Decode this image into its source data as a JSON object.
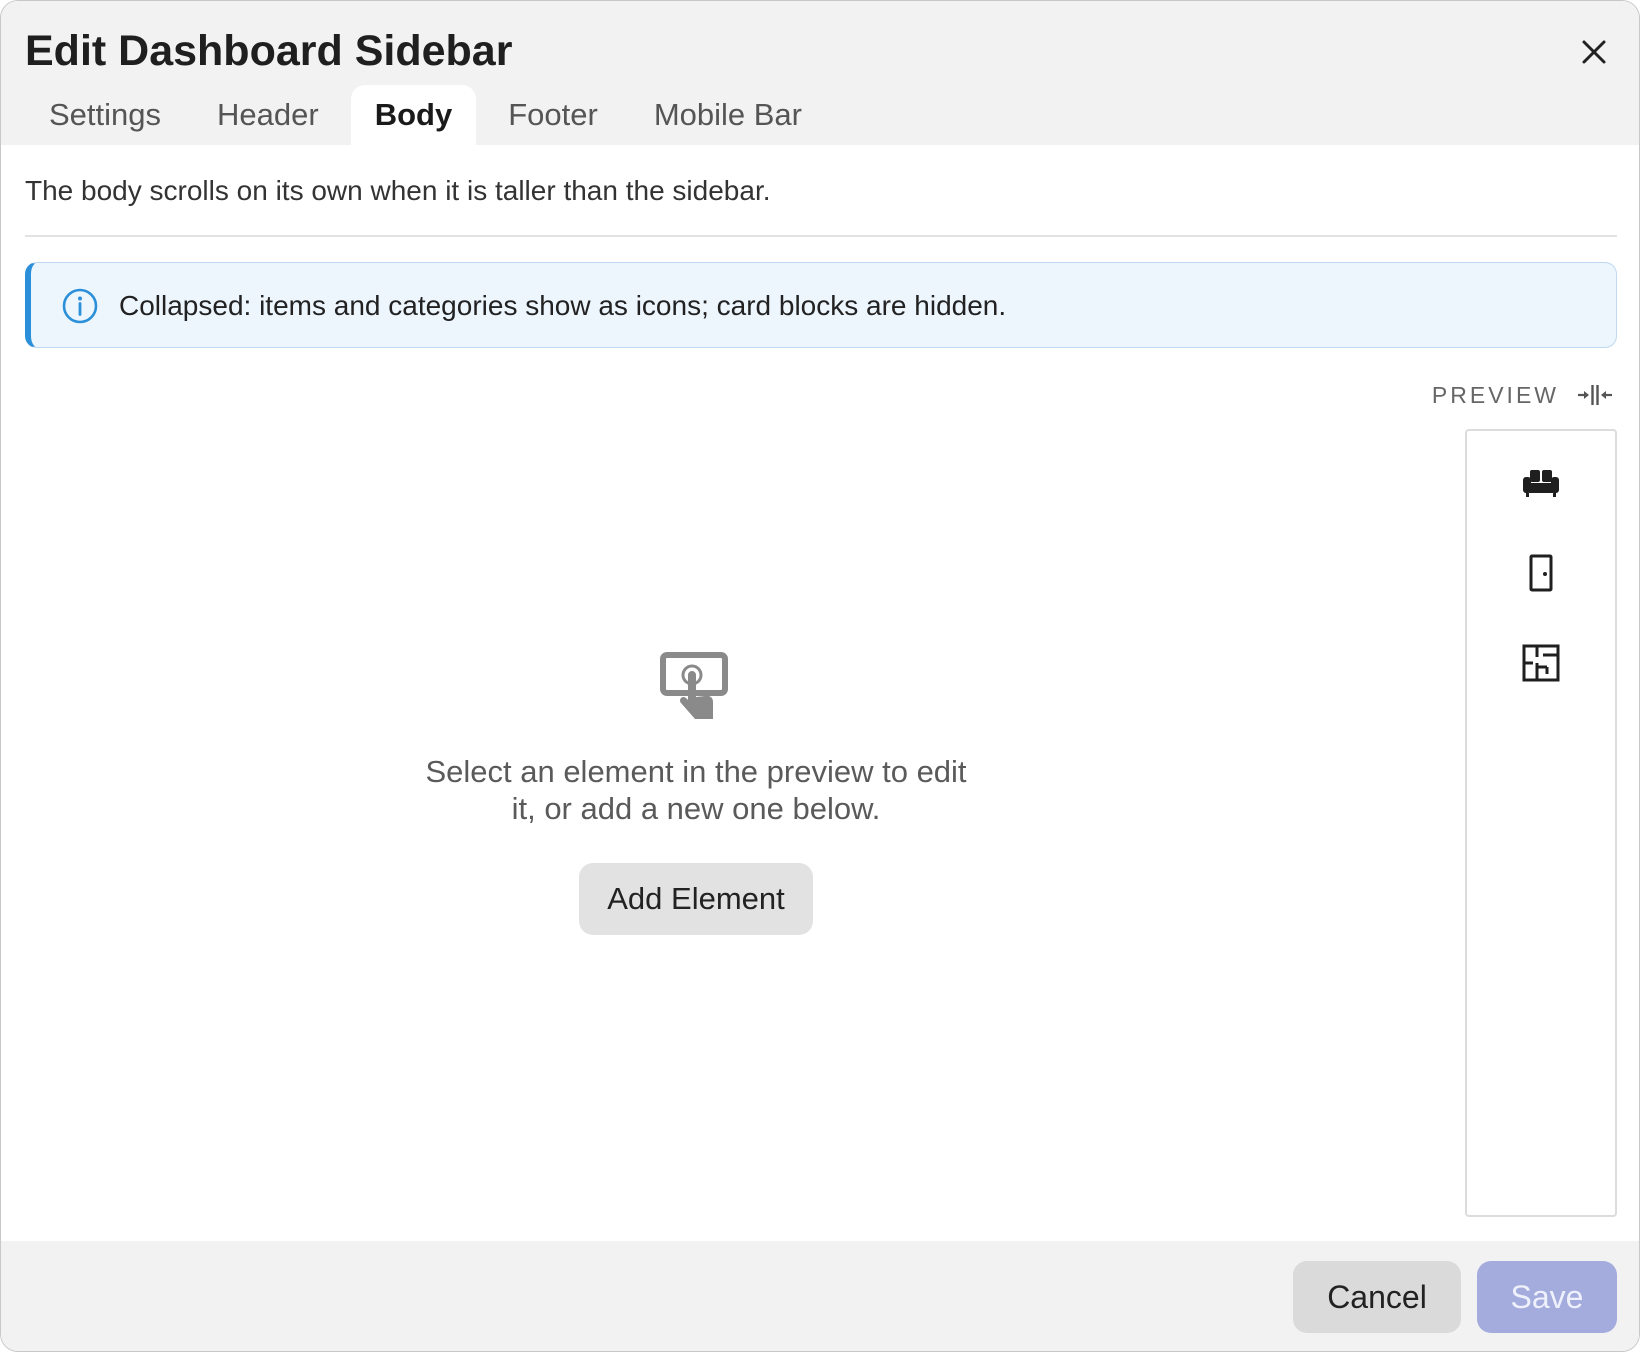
{
  "dialog": {
    "title": "Edit Dashboard Sidebar",
    "close_icon": "close-icon"
  },
  "tabs": [
    {
      "label": "Settings",
      "active": false
    },
    {
      "label": "Header",
      "active": false
    },
    {
      "label": "Body",
      "active": true
    },
    {
      "label": "Footer",
      "active": false
    },
    {
      "label": "Mobile Bar",
      "active": false
    }
  ],
  "body": {
    "description": "The body scrolls on its own when it is taller than the sidebar.",
    "info": {
      "icon": "info-icon",
      "text": "Collapsed: items and categories show as icons; card blocks are hidden.",
      "accent_color": "#2c8fd9"
    },
    "preview": {
      "label": "PREVIEW",
      "collapse_icon": "collapse-horizontal-icon",
      "items": [
        {
          "icon": "sofa-icon"
        },
        {
          "icon": "door-icon"
        },
        {
          "icon": "floor-plan-icon"
        }
      ]
    },
    "empty_state": {
      "icon": "touch-screen-icon",
      "text": "Select an element in the preview to edit it, or add a new one below.",
      "button_label": "Add Element"
    }
  },
  "footer": {
    "cancel_label": "Cancel",
    "save_label": "Save",
    "save_color": "#a3acdc"
  }
}
